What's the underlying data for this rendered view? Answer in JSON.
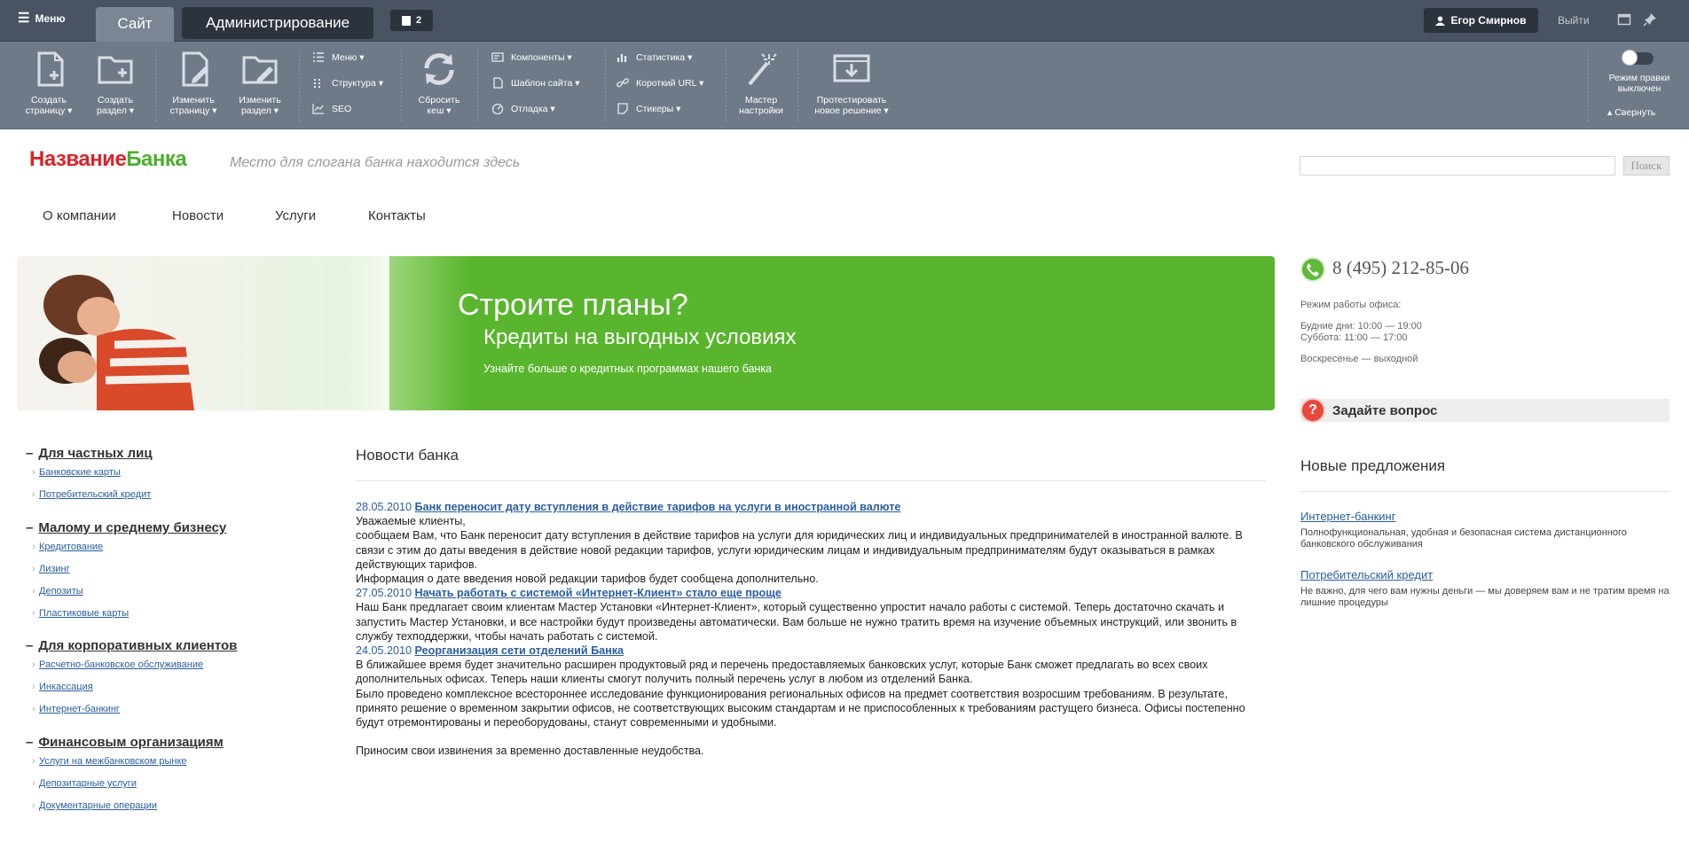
{
  "topbar": {
    "menu_label": "Меню",
    "tab_site": "Сайт",
    "tab_admin": "Администрирование",
    "notifications_count": "2",
    "user_name": "Егор Смирнов",
    "logout_label": "Выйти"
  },
  "toolbar": {
    "create_page": [
      "Создать",
      "страницу ▾"
    ],
    "create_section": [
      "Создать",
      "раздел ▾"
    ],
    "edit_page": [
      "Изменить",
      "страницу ▾"
    ],
    "edit_section": [
      "Изменить",
      "раздел ▾"
    ],
    "menu": "Меню ▾",
    "structure": "Структура ▾",
    "seo": "SEO",
    "clear_cache": [
      "Сбросить",
      "кеш ▾"
    ],
    "components": "Компоненты ▾",
    "site_template": "Шаблон сайта ▾",
    "debug": "Отладка ▾",
    "statistics": "Статистика ▾",
    "short_url": "Короткий URL ▾",
    "stickers": "Стикеры ▾",
    "wizard": [
      "Мастер",
      "настройки"
    ],
    "test_solution": [
      "Протестировать",
      "новое решение ▾"
    ],
    "edit_mode": [
      "Режим правки",
      "выключен"
    ],
    "collapse": "▴ Свернуть"
  },
  "site": {
    "logo_part1": "Название",
    "logo_part2": "Банка",
    "slogan": "Место для слогана банка находится здесь",
    "search_button": "Поиск",
    "nav": [
      "О компании",
      "Новости",
      "Услуги",
      "Контакты"
    ]
  },
  "banner": {
    "title": "Строите планы?",
    "subtitle": "Кредиты на выгодных условиях",
    "text": "Узнайте больше о кредитных программах нашего банка"
  },
  "sidebar": {
    "phone": "8 (495) 212-85-06",
    "hours_title": "Режим работы офиса:",
    "hours_weekdays": "Будние дни: 10:00 — 19:00",
    "hours_saturday": "Суббота: 11:00 — 17:00",
    "hours_sunday": "Воскресенье — выходной",
    "ask_question": "Задайте вопрос",
    "offers_title": "Новые предложения",
    "offers": [
      {
        "title": "Интернет-банкинг",
        "desc": "Полнофункциональная, удобная и безопасная система дистанционного банковского обслуживания"
      },
      {
        "title": "Потребительский кредит",
        "desc": "Не важно, для чего вам нужны деньги — мы доверяем вам и не тратим время на лишние процедуры"
      }
    ]
  },
  "left_menu": [
    {
      "title": "Для частных лиц",
      "items": [
        "Банковские карты",
        "Потребительский кредит"
      ]
    },
    {
      "title": "Малому и среднему бизнесу",
      "items": [
        "Кредитование",
        "Лизинг",
        "Депозиты",
        "Пластиковые карты"
      ]
    },
    {
      "title": "Для корпоративных клиентов",
      "items": [
        "Расчетно-банковское обслуживание",
        "Инкассация",
        "Интернет-банкинг"
      ]
    },
    {
      "title": "Финансовым организациям",
      "items": [
        "Услуги на межбанковском рынке",
        "Депозитарные услуги",
        "Документарные операции"
      ]
    }
  ],
  "news": {
    "title": "Новости банка",
    "items": [
      {
        "date": "28.05.2010",
        "title": "Банк переносит дату вступления в действие тарифов на услуги в иностранной валюте",
        "lines": [
          "Уважаемые клиенты,",
          "сообщаем Вам, что Банк переносит дату вступления в действие тарифов на услуги для юридических лиц и индивидуальных предпринимателей в иностранной валюте. В связи с этим до даты введения в действие новой редакции тарифов, услуги юридическим лицам и индивидуальным предпринимателям будут оказываться в рамках действующих тарифов.",
          "Информация о дате введения новой редакции тарифов будет сообщена дополнительно."
        ]
      },
      {
        "date": "27.05.2010",
        "title": "Начать работать с системой «Интернет-Клиент» стало еще проще",
        "lines": [
          "Наш Банк предлагает своим клиентам Мастер Установки «Интернет-Клиент», который существенно упростит начало работы с системой. Теперь достаточно скачать и запустить Мастер Установки, и все настройки будут произведены автоматически. Вам больше не нужно тратить время на изучение объемных инструкций, или звонить в службу техподдержки, чтобы начать работать с системой."
        ]
      },
      {
        "date": "24.05.2010",
        "title": "Реорганизация сети отделений Банка",
        "lines": [
          "В ближайшее время будет значительно расширен продуктовый ряд и перечень предоставляемых банковских услуг, которые Банк сможет предлагать во всех своих дополнительных офисах. Теперь наши клиенты смогут получить полный перечень услуг в любом из отделений Банка.",
          "Было проведено комплексное всестороннее исследование функционирования региональных офисов на предмет соответствия возросшим требованиям. В результате, принято решение о временном закрытии офисов, не соответствующих высоким стандартам и не приспособленных к требованиям растущего бизнеса. Офисы постепенно будут отремонтированы и переоборудованы, станут современными и удобными."
        ]
      }
    ],
    "apology": "Приносим свои извинения за временно доставленные неудобства."
  }
}
